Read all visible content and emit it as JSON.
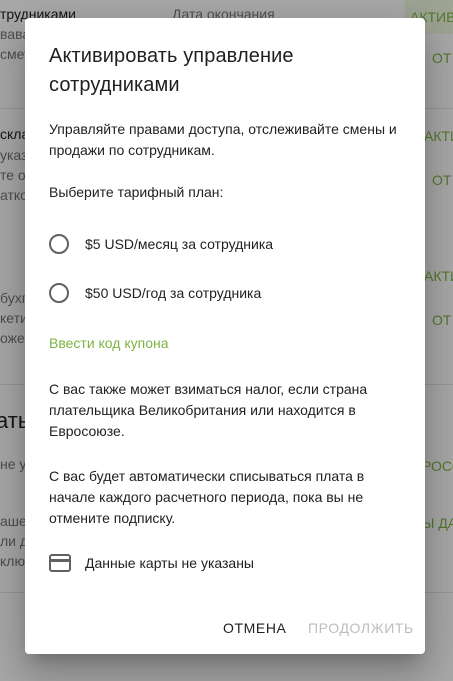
{
  "background": {
    "header_col1": "трудниками",
    "header_col2": "Дата окончания",
    "header_active": "АКТИВ",
    "row1_a": "вава",
    "row1_b": "смет",
    "row1_action": "ОТ",
    "row2_a": "скла",
    "row2_b": "указ",
    "row2_c": "те о",
    "row2_d": "атко",
    "row2_active": "АКТИВ",
    "row2_action": "ОТ",
    "row3_a": "бухга",
    "row3_b": "кети",
    "row3_c": "ожен",
    "row3_active": "АКТИВ",
    "row3_action": "ОТ",
    "section_title": "аты",
    "row4_a": "не у",
    "row4_action": "РОСО",
    "row5_a": "аше",
    "row5_b": "ли д",
    "row5_c": "ключ",
    "row5_action": "Ы ДА"
  },
  "dialog": {
    "title": "Активировать управление сотрудниками",
    "description": "Управляйте правами доступа, отслеживайте смены и продажи по сотрудникам.",
    "plan_prompt": "Выберите тарифный план:",
    "plans": [
      {
        "label": "$5 USD/месяц за сотрудника",
        "selected": false
      },
      {
        "label": "$50 USD/год за сотрудника",
        "selected": false
      }
    ],
    "coupon_link": "Ввести код купона",
    "tax_note": "С вас также может взиматься налог, если страна плательщика Великобритания или находится в Евросоюзе.",
    "billing_note": "С вас будет автоматически списываться плата в начале каждого расчетного периода, пока вы не отмените подписку.",
    "card_status": "Данные карты не указаны",
    "card_icon": "credit-card-icon",
    "cancel_label": "ОТМЕНА",
    "continue_label": "ПРОДОЛЖИТЬ",
    "continue_disabled": true
  },
  "colors": {
    "accent": "#7cb342",
    "disabled": "#bdbdbd",
    "text": "#212121"
  }
}
